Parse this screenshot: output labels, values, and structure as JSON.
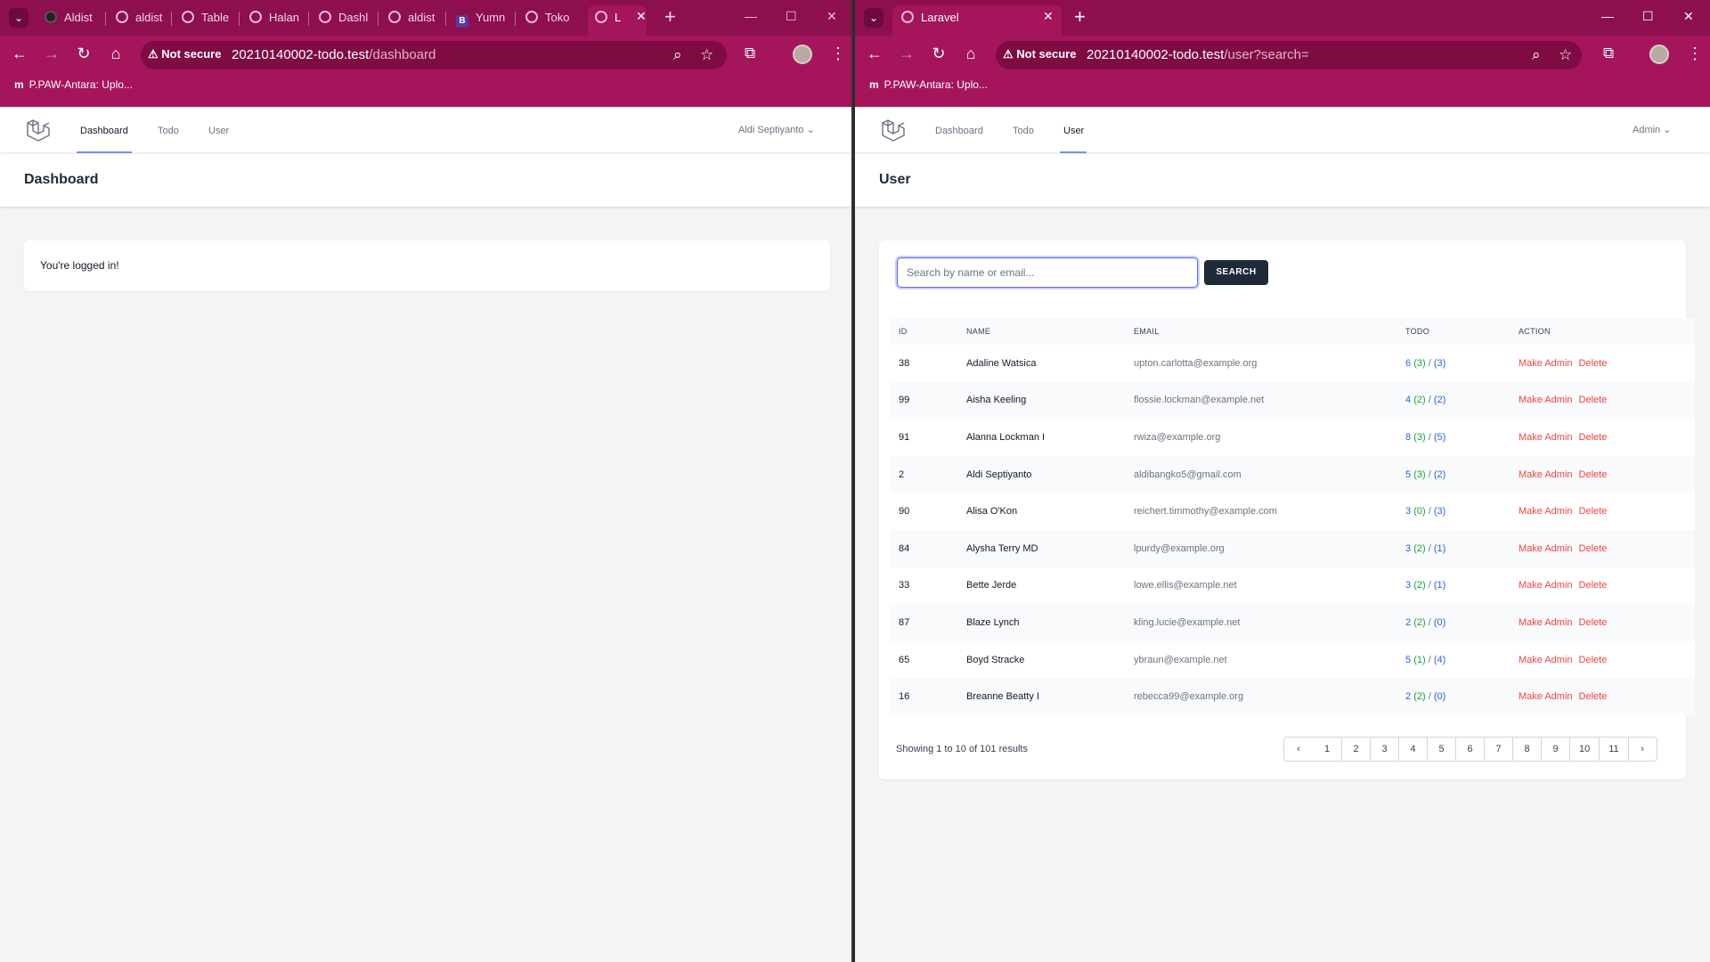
{
  "left_window": {
    "tabs": [
      {
        "label": "Aldist",
        "icon": "github-icon"
      },
      {
        "label": "aldist",
        "icon": "globe-icon"
      },
      {
        "label": "Table",
        "icon": "globe-icon"
      },
      {
        "label": "Halan",
        "icon": "globe-icon"
      },
      {
        "label": "Dashl",
        "icon": "globe-icon"
      },
      {
        "label": "aldist",
        "icon": "globe-icon"
      },
      {
        "label": "Yumn",
        "icon": "bootstrap-icon"
      },
      {
        "label": "Toko",
        "icon": "globe-icon"
      },
      {
        "label": "L",
        "icon": "globe-icon",
        "active": true
      }
    ],
    "not_secure": "Not secure",
    "url_host": "20210140002-todo.test",
    "url_path": "/dashboard",
    "bookmark": "P.PAW-Antara: Uplo...",
    "nav": {
      "dashboard": "Dashboard",
      "todo": "Todo",
      "user": "User"
    },
    "user_name": "Aldi Septiyanto",
    "page_title": "Dashboard",
    "message": "You're logged in!"
  },
  "right_window": {
    "tab_title": "Laravel",
    "not_secure": "Not secure",
    "url_host": "20210140002-todo.test",
    "url_path": "/user?search=",
    "bookmark": "P.PAW-Antara: Uplo...",
    "nav": {
      "dashboard": "Dashboard",
      "todo": "Todo",
      "user": "User"
    },
    "user_name": "Admin",
    "page_title": "User",
    "search_placeholder": "Search by name or email...",
    "search_button": "SEARCH",
    "columns": {
      "id": "ID",
      "name": "NAME",
      "email": "EMAIL",
      "todo": "TODO",
      "action": "ACTION"
    },
    "rows": [
      {
        "id": "38",
        "name": "Adaline Watsica",
        "email": "upton.carlotta@example.org",
        "total": "6",
        "done": "(3)",
        "open": "(3)"
      },
      {
        "id": "99",
        "name": "Aisha Keeling",
        "email": "flossie.lockman@example.net",
        "total": "4",
        "done": "(2)",
        "open": "(2)"
      },
      {
        "id": "91",
        "name": "Alanna Lockman I",
        "email": "rwiza@example.org",
        "total": "8",
        "done": "(3)",
        "open": "(5)"
      },
      {
        "id": "2",
        "name": "Aldi Septiyanto",
        "email": "aldibangko5@gmail.com",
        "total": "5",
        "done": "(3)",
        "open": "(2)"
      },
      {
        "id": "90",
        "name": "Alisa O'Kon",
        "email": "reichert.timmothy@example.com",
        "total": "3",
        "done": "(0)",
        "open": "(3)"
      },
      {
        "id": "84",
        "name": "Alysha Terry MD",
        "email": "lpurdy@example.org",
        "total": "3",
        "done": "(2)",
        "open": "(1)"
      },
      {
        "id": "33",
        "name": "Bette Jerde",
        "email": "lowe.ellis@example.net",
        "total": "3",
        "done": "(2)",
        "open": "(1)"
      },
      {
        "id": "87",
        "name": "Blaze Lynch",
        "email": "kling.lucie@example.net",
        "total": "2",
        "done": "(2)",
        "open": "(0)"
      },
      {
        "id": "65",
        "name": "Boyd Stracke",
        "email": "ybraun@example.net",
        "total": "5",
        "done": "(1)",
        "open": "(4)"
      },
      {
        "id": "16",
        "name": "Breanne Beatty I",
        "email": "rebecca99@example.org",
        "total": "2",
        "done": "(2)",
        "open": "(0)"
      }
    ],
    "make_admin": "Make Admin",
    "delete": "Delete",
    "showing": "Showing 1 to 10 of 101 results",
    "pages": [
      "1",
      "2",
      "3",
      "4",
      "5",
      "6",
      "7",
      "8",
      "9",
      "10",
      "11"
    ]
  },
  "colors": {
    "browser_frame": "#a4155b",
    "accent": "#6366f1",
    "danger": "#ef4444",
    "done_green": "#16a34a",
    "link_blue": "#2563eb"
  }
}
